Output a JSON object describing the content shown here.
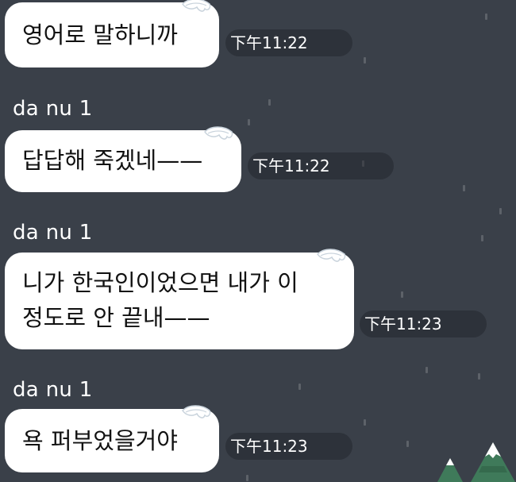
{
  "conversation": {
    "messages": [
      {
        "sender": "",
        "lines": [
          "영어로 말하니까"
        ],
        "time": "下午11:22"
      },
      {
        "sender": "da nu 1",
        "lines": [
          "답답해 죽겠네——"
        ],
        "time": "下午11:22"
      },
      {
        "sender": "da nu 1",
        "lines": [
          "니가 한국인이었으면 내가 이",
          "정도로 안 끝내——"
        ],
        "time": "下午11:23"
      },
      {
        "sender": "da nu 1",
        "lines": [
          "욕 퍼부었을거야"
        ],
        "time": "下午11:23"
      }
    ]
  },
  "theme": {
    "background": "#3a4049",
    "bubble": "#ffffff",
    "text": "#111111",
    "sender_text": "#ffffff",
    "time_text": "#ffffff",
    "tree": "#3f7a5a",
    "snow": "#ffffff"
  },
  "decorations": {
    "bubble_corner": "snow-cap-icon",
    "bottom_right": "snowy-tree-icon"
  }
}
